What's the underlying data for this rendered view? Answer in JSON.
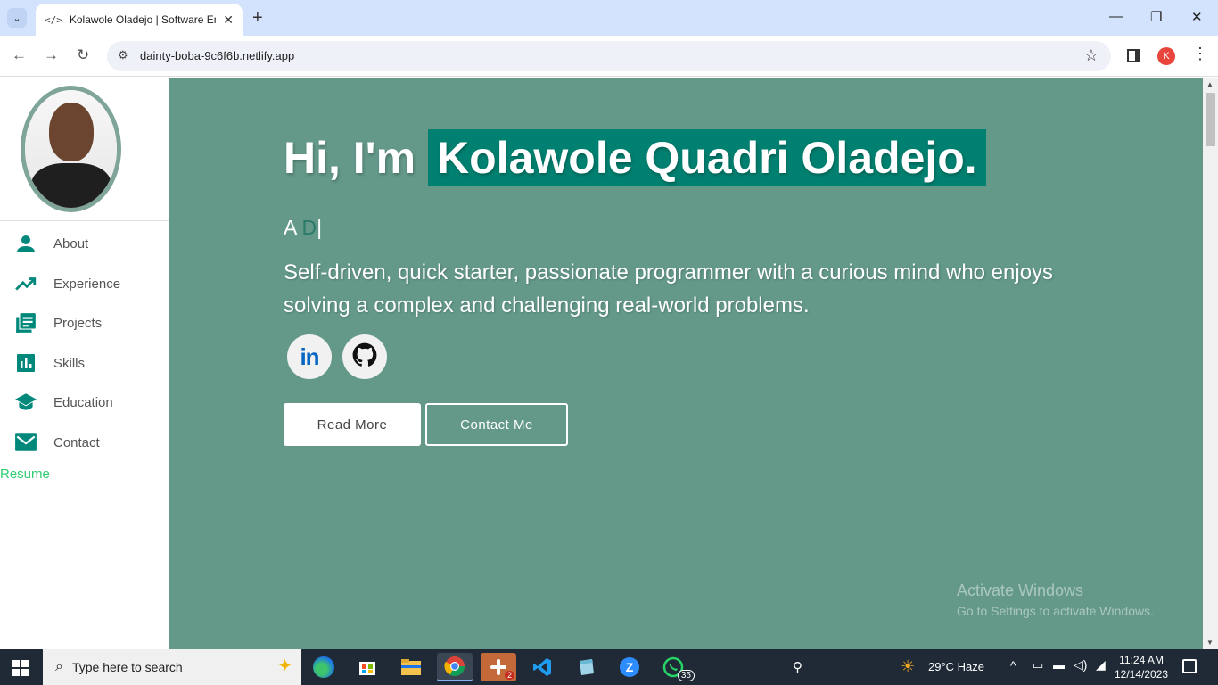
{
  "browser": {
    "tab_title": "Kolawole Oladejo | Software Engineer",
    "tab_favicon": "</>",
    "tab_close": "✕",
    "new_tab": "+",
    "url": "dainty-boba-9c6f6b.netlify.app",
    "profile_initial": "K",
    "buttons": {
      "back": "←",
      "forward": "→",
      "reload": "↻",
      "star": "☆",
      "menu": "⋮",
      "minimize": "—",
      "restore": "❐",
      "close": "✕",
      "tab_menu": "⌄",
      "site_info": "⚙"
    }
  },
  "sidebar": {
    "items": [
      {
        "label": "About",
        "icon": "person-icon"
      },
      {
        "label": "Experience",
        "icon": "trending-up-icon"
      },
      {
        "label": "Projects",
        "icon": "library-books-icon"
      },
      {
        "label": "Skills",
        "icon": "bar-chart-icon"
      },
      {
        "label": "Education",
        "icon": "school-icon"
      },
      {
        "label": "Contact",
        "icon": "mail-icon"
      }
    ],
    "resume_label": "Resume"
  },
  "hero": {
    "greeting": "Hi, I'm",
    "name": "Kolawole Quadri Oladejo.",
    "typed_prefix": "A ",
    "typed_partial": "D",
    "typed_cursor": "|",
    "bio": "Self-driven, quick starter, passionate programmer with a curious mind who enjoys solving a complex and challenging real-world problems.",
    "linkedin_label": "in",
    "read_more": "Read More",
    "contact": "Contact Me"
  },
  "watermark": {
    "title": "Activate Windows",
    "subtitle": "Go to Settings to activate Windows."
  },
  "taskbar": {
    "search_placeholder": "Type here to search",
    "slack_badge": "2",
    "whatsapp_badge": "35",
    "weather": "29°C  Haze",
    "time": "11:24 AM",
    "date": "12/14/2023"
  },
  "colors": {
    "main_bg": "#64998a",
    "name_highlight": "#008070",
    "icon_teal": "#00897b",
    "resume_green": "#2ecc71"
  }
}
